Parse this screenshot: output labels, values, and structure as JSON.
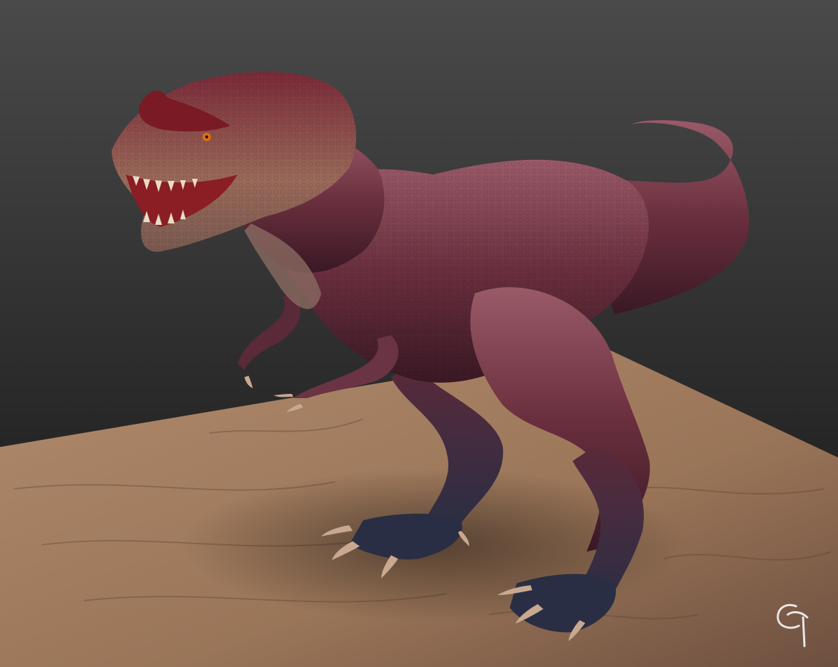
{
  "scene": {
    "subject": "dinosaur",
    "colors": {
      "background_top": "#4a4a4a",
      "background_bottom": "#141414",
      "ground_light": "#b08a6c",
      "ground_dark": "#6e5040",
      "skin_main": "#6a2f3e",
      "skin_highlight": "#9a5a68",
      "skin_dark": "#3a1824",
      "belly": "#8a6a62",
      "feet": "#2a2e44",
      "claws": "#c9a890",
      "eye": "#e07010",
      "mouth": "#8a1e24",
      "signature": "#e8e8e8"
    },
    "icons": [
      "signature-logo-icon"
    ]
  }
}
